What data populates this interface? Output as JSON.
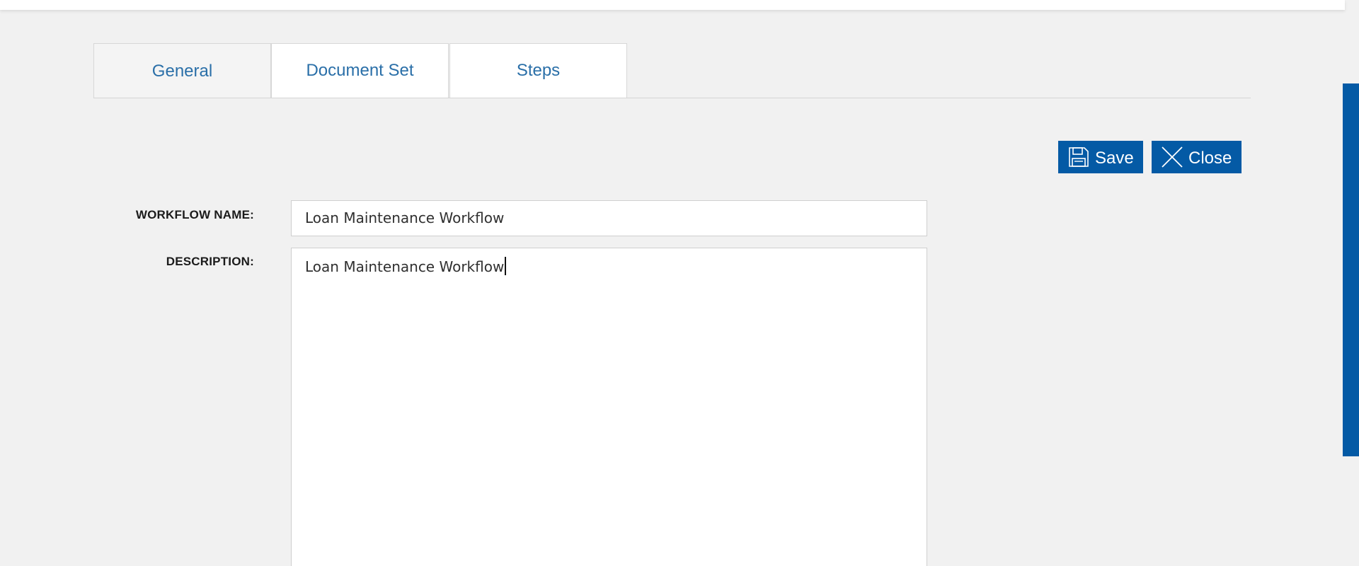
{
  "tabs": [
    {
      "label": "General",
      "active": true
    },
    {
      "label": "Document Set",
      "active": false
    },
    {
      "label": "Steps",
      "active": false
    }
  ],
  "toolbar": {
    "save_label": "Save",
    "save_icon": "floppy-disk-icon",
    "close_label": "Close",
    "close_icon": "close-x-icon"
  },
  "form": {
    "workflow_name": {
      "label": "WORKFLOW NAME:",
      "value": "Loan Maintenance Workflow"
    },
    "description": {
      "label": "DESCRIPTION:",
      "value": "Loan Maintenance Workflow"
    }
  },
  "colors": {
    "accent": "#045aa5",
    "tab_text": "#2a6fa8",
    "background": "#f1f1f1"
  }
}
